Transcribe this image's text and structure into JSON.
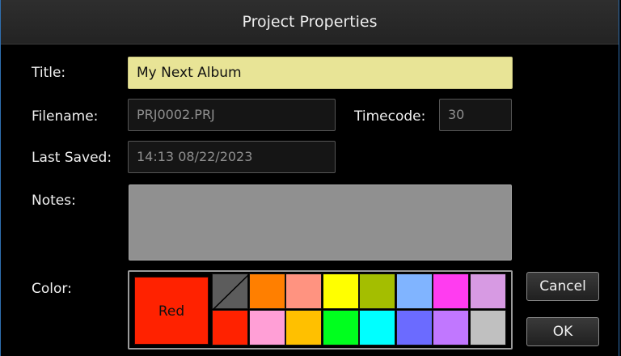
{
  "dialog": {
    "title": "Project Properties"
  },
  "fields": {
    "title_label": "Title:",
    "title_value": "My Next Album",
    "filename_label": "Filename:",
    "filename_value": "PRJ0002.PRJ",
    "timecode_label": "Timecode:",
    "timecode_value": "30",
    "last_saved_label": "Last Saved:",
    "last_saved_value": "14:13 08/22/2023",
    "notes_label": "Notes:",
    "notes_value": ""
  },
  "color": {
    "label": "Color:",
    "selected_name": "Red",
    "selected_hex": "#ff2200",
    "top_row": [
      "none",
      "#ff7f00",
      "#ff9380",
      "#ffff00",
      "#a4be00",
      "#80b4ff",
      "#ff3cf0",
      "#d79ae3"
    ],
    "bottom_row": [
      "#ff2200",
      "#ff9fd6",
      "#ffc000",
      "#00ff1e",
      "#00ffff",
      "#6b6bff",
      "#c177ff",
      "#c0c0c0"
    ]
  },
  "buttons": {
    "cancel": "Cancel",
    "ok": "OK"
  }
}
